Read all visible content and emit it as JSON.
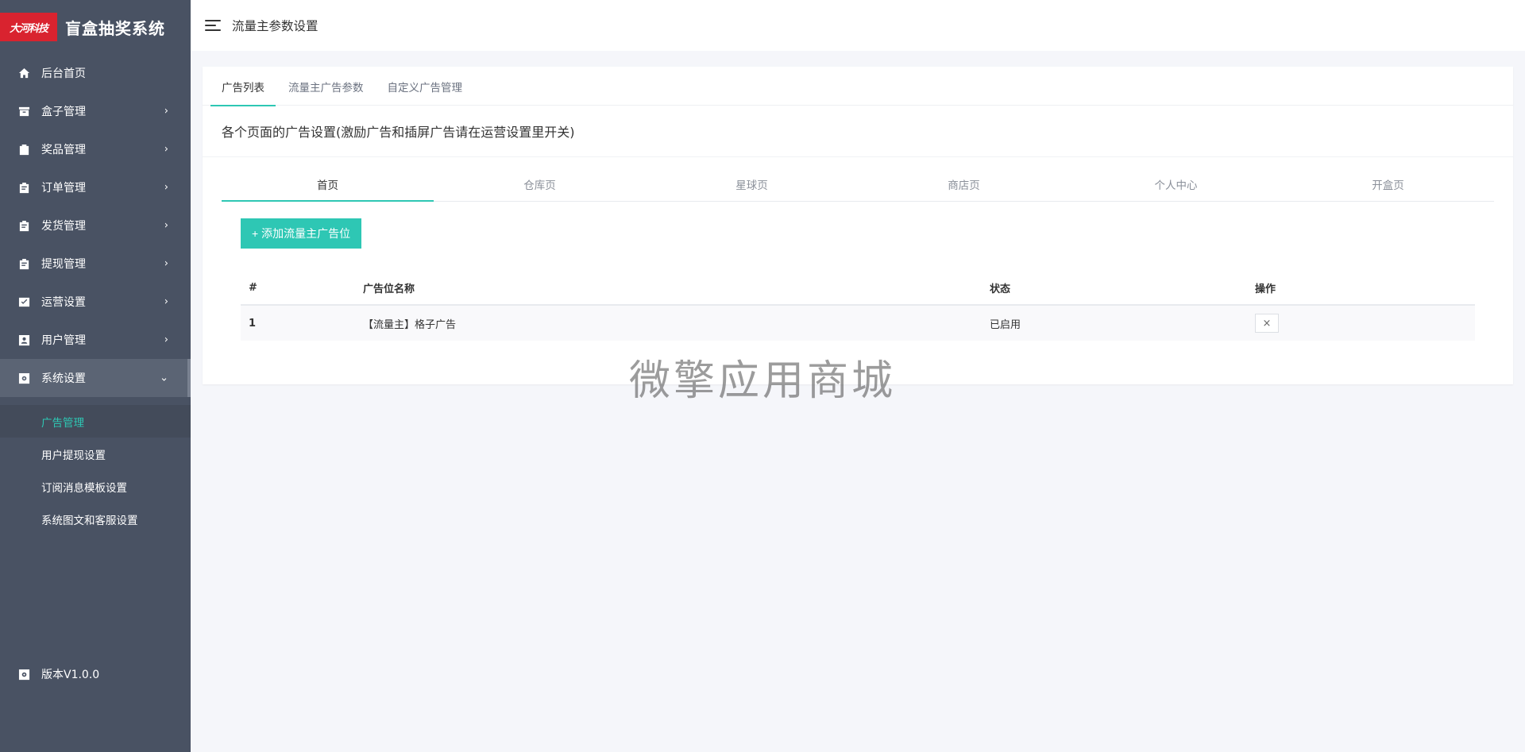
{
  "brand": {
    "logo_text": "大河科技",
    "title": "盲盒抽奖系统",
    "logo_color": "#d9232f"
  },
  "colors": {
    "sidebar_bg": "#495263",
    "accent": "#2ec7b4"
  },
  "sidebar": {
    "items": [
      {
        "label": "后台首页",
        "icon": "home-icon"
      },
      {
        "label": "盒子管理",
        "icon": "box-icon"
      },
      {
        "label": "奖品管理",
        "icon": "bag-icon"
      },
      {
        "label": "订单管理",
        "icon": "clipboard-icon"
      },
      {
        "label": "发货管理",
        "icon": "clipboard-icon"
      },
      {
        "label": "提现管理",
        "icon": "clipboard-icon"
      },
      {
        "label": "运营设置",
        "icon": "check-box-icon"
      },
      {
        "label": "用户管理",
        "icon": "user-box-icon"
      },
      {
        "label": "系统设置",
        "icon": "gear-box-icon"
      }
    ],
    "subitems": [
      "广告管理",
      "用户提现设置",
      "订阅消息模板设置",
      "系统图文和客服设置"
    ],
    "version": "版本V1.0.0"
  },
  "header": {
    "title": "流量主参数设置"
  },
  "tabs": [
    "广告列表",
    "流量主广告参数",
    "自定义广告管理"
  ],
  "section_title": "各个页面的广告设置(激励广告和插屏广告请在运营设置里开关)",
  "page_tabs": [
    "首页",
    "仓库页",
    "星球页",
    "商店页",
    "个人中心",
    "开盒页"
  ],
  "add_button": "+ 添加流量主广告位",
  "table": {
    "headers": [
      "#",
      "广告位名称",
      "状态",
      "操作"
    ],
    "rows": [
      {
        "id": "1",
        "name": "【流量主】格子广告",
        "status": "已启用",
        "action": "×"
      }
    ]
  },
  "watermark": "微擎应用商城"
}
